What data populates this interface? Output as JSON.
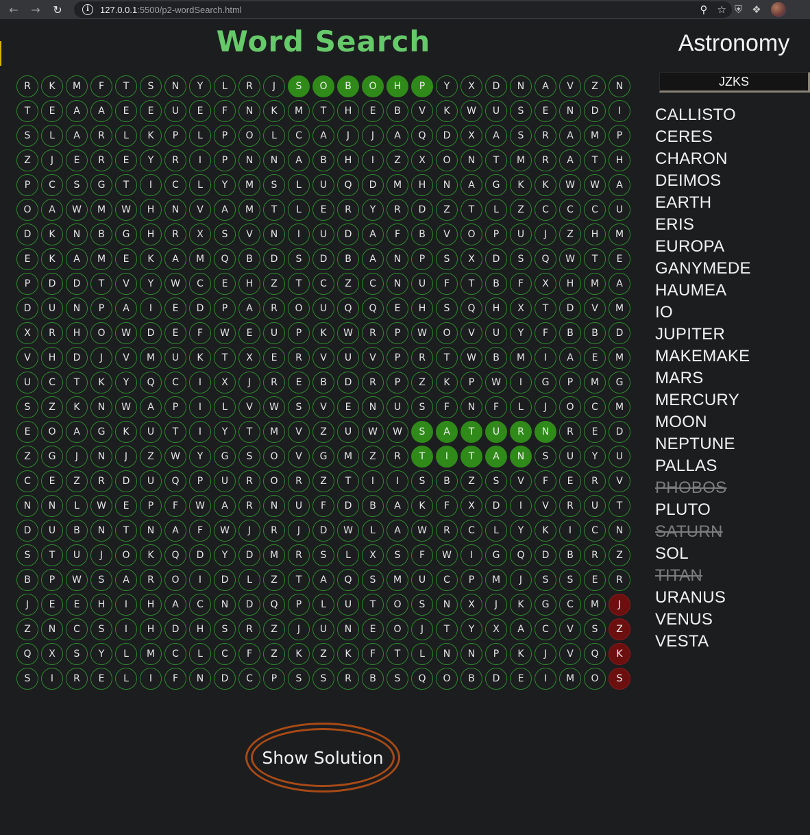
{
  "browser": {
    "url_host": "127.0.0.1",
    "url_path": ":5500/p2-wordSearch.html"
  },
  "page": {
    "title": "Word Search",
    "theme": "Astronomy",
    "current_selection": "JZKS",
    "solution_button": "Show Solution"
  },
  "grid": [
    "RKMFTSNYLRJSOBOHPYXDNAVZN",
    "TEAAEEUEFNKMTHEBVKWUSENDI",
    "SLARLKPLPOLCAJJAQDXASRAMP",
    "ZJEREYRIPNNABHIZXONTMRATH",
    "PCSGTICLYMSLUQDMHNAGKKWWA",
    "OAWMWHNVAMTLERYRDZTLZCCCU",
    "DKNBGHRXSVNIUDAFBVOPUJZHM",
    "EKAMEKAMQBDSDBANPSXDSQWTE",
    "PDDTVYWCEHZTCZCNUFTBFXHMA",
    "DUNPAIEDPAROUQQEHSQHXTDVM",
    "XRHOWDEFWEUPKWRPWOVUYFBBD",
    "VHDJVMUKTXERVUVPRTWBMIAEM",
    "UCTKYQCIXJREBDRPZKPWIGPMG",
    "SZKNWAPILVWSVENUSFNFLJOCM",
    "EOAGKUTIYTMVZUWWSATURNRED",
    "ZGJNJZWYGSOVGMZRTITANSUYU",
    "CEZRDUQPURORZTIISBZSVFERV",
    "NNLWEPFWARNUFDBAKFXDIVRUT",
    "DUBNTNAFWJRJDWLAWRCLYKICN",
    "STUJOKQDYDMRSLXSFWIGQDBRZ",
    "BPWSAROIDLZTAQSMUCPMJSSER",
    "JEEHIHACNDQPLUTOSNXJKGCMJ",
    "ZNCSIHDHSRZJUNEOJTYXACVSZ",
    "QXSYLMCLCFZKZKFTLNNPKJVQK",
    "SIRELIFNDCPSSRBSQOBDEIMOS"
  ],
  "found_cells": [
    [
      0,
      11
    ],
    [
      0,
      12
    ],
    [
      0,
      13
    ],
    [
      0,
      14
    ],
    [
      0,
      15
    ],
    [
      0,
      16
    ],
    [
      14,
      16
    ],
    [
      14,
      17
    ],
    [
      14,
      18
    ],
    [
      14,
      19
    ],
    [
      14,
      20
    ],
    [
      14,
      21
    ],
    [
      15,
      16
    ],
    [
      15,
      17
    ],
    [
      15,
      18
    ],
    [
      15,
      19
    ],
    [
      15,
      20
    ]
  ],
  "current_cells": [
    [
      21,
      24
    ],
    [
      22,
      24
    ],
    [
      23,
      24
    ],
    [
      24,
      24
    ]
  ],
  "colors": {
    "found": "#2f8a19",
    "current": "#6b0f0f",
    "title": "#66c96a",
    "cell_border": "#2e8a2e",
    "button_border": "#a84a16"
  },
  "words": [
    {
      "text": "CALLISTO",
      "found": false
    },
    {
      "text": "CERES",
      "found": false
    },
    {
      "text": "CHARON",
      "found": false
    },
    {
      "text": "DEIMOS",
      "found": false
    },
    {
      "text": "EARTH",
      "found": false
    },
    {
      "text": "ERIS",
      "found": false
    },
    {
      "text": "EUROPA",
      "found": false
    },
    {
      "text": "GANYMEDE",
      "found": false
    },
    {
      "text": "HAUMEA",
      "found": false
    },
    {
      "text": "IO",
      "found": false
    },
    {
      "text": "JUPITER",
      "found": false
    },
    {
      "text": "MAKEMAKE",
      "found": false
    },
    {
      "text": "MARS",
      "found": false
    },
    {
      "text": "MERCURY",
      "found": false
    },
    {
      "text": "MOON",
      "found": false
    },
    {
      "text": "NEPTUNE",
      "found": false
    },
    {
      "text": "PALLAS",
      "found": false
    },
    {
      "text": "PHOBOS",
      "found": true
    },
    {
      "text": "PLUTO",
      "found": false
    },
    {
      "text": "SATURN",
      "found": true
    },
    {
      "text": "SOL",
      "found": false
    },
    {
      "text": "TITAN",
      "found": true
    },
    {
      "text": "URANUS",
      "found": false
    },
    {
      "text": "VENUS",
      "found": false
    },
    {
      "text": "VESTA",
      "found": false
    }
  ]
}
